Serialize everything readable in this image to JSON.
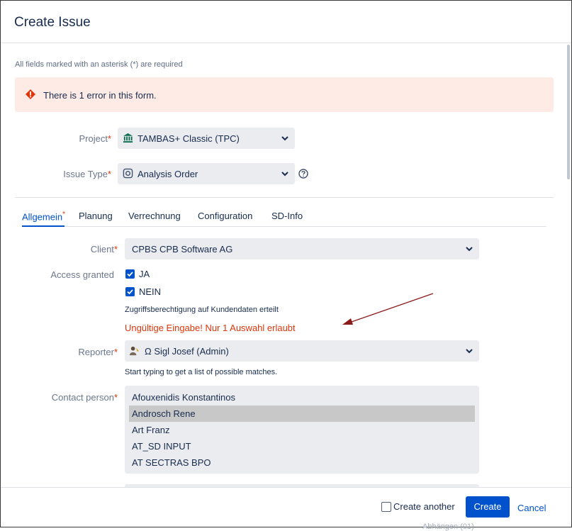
{
  "dialog": {
    "title": "Create Issue"
  },
  "form": {
    "required_note": "All fields marked with an asterisk (*) are required",
    "error_banner": "There is 1 error in this form.",
    "asterisk": "*",
    "project": {
      "label": "Project",
      "value": "TAMBAS+ Classic (TPC)",
      "icon": "bank-icon"
    },
    "issue_type": {
      "label": "Issue Type",
      "value": "Analysis Order",
      "icon": "analysis-order-icon"
    }
  },
  "tabs": [
    {
      "label": "Allgemein",
      "active": true
    },
    {
      "label": "Planung"
    },
    {
      "label": "Verrechnung"
    },
    {
      "label": "Configuration"
    },
    {
      "label": "SD-Info"
    }
  ],
  "client": {
    "label": "Client",
    "value": "CPBS CPB Software AG"
  },
  "access_granted": {
    "label": "Access granted",
    "options": [
      {
        "label": "JA",
        "checked": true
      },
      {
        "label": "NEIN",
        "checked": true
      }
    ],
    "hint": "Zugriffsberechtigung auf Kundendaten erteilt",
    "error": "Ungültige Eingabe! Nur 1 Auswahl erlaubt"
  },
  "reporter": {
    "label": "Reporter",
    "value": "Ω Sigl Josef (Admin)",
    "hint": "Start typing to get a list of possible matches."
  },
  "contact_person": {
    "label": "Contact person",
    "options": [
      {
        "label": "Afouxenidis Konstantinos",
        "selected": false
      },
      {
        "label": "Androsch Rene",
        "selected": true
      },
      {
        "label": "Art Franz",
        "selected": false
      },
      {
        "label": "AT_SD INPUT",
        "selected": false
      },
      {
        "label": "AT SECTRAS BPO",
        "selected": false
      }
    ]
  },
  "footer": {
    "create_another": "Create another",
    "create": "Create",
    "cancel": "Cancel",
    "below_text": "Abhängen (01)"
  },
  "colors": {
    "accent": "#0052cc",
    "error": "#de350b",
    "error_bg": "#ffebe6",
    "annotation_arrow": "#8b1a1a"
  }
}
